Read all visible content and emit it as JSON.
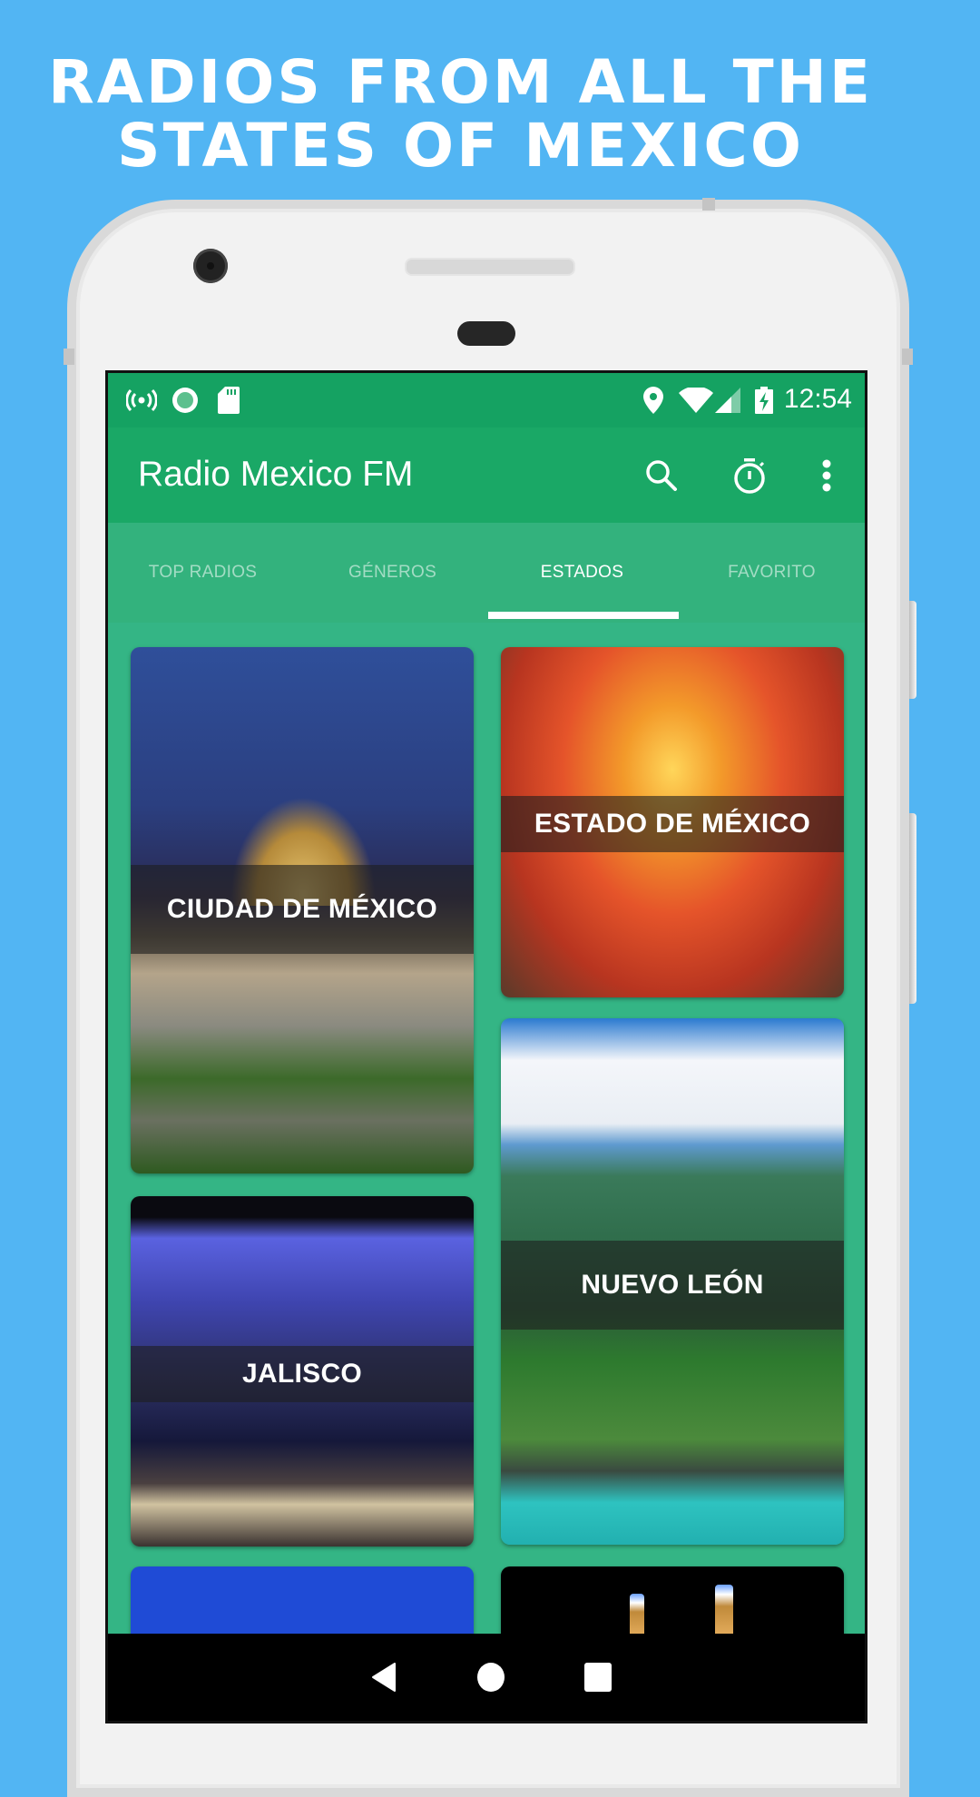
{
  "promo": {
    "headline_line1": "RADIOS FROM ALL THE",
    "headline_line2": "STATES OF MEXICO"
  },
  "status_bar": {
    "left_icons": [
      "broadcast-icon",
      "record-icon",
      "sd-card-icon"
    ],
    "right_icons": [
      "location-icon",
      "wifi-icon",
      "cell-signal-icon",
      "battery-charging-icon"
    ],
    "time": "12:54"
  },
  "app_bar": {
    "title": "Radio Mexico FM",
    "actions": [
      "search-icon",
      "timer-icon",
      "more-vert-icon"
    ]
  },
  "tabs": [
    {
      "label": "TOP RADIOS",
      "active": false
    },
    {
      "label": "GÉNEROS",
      "active": false
    },
    {
      "label": "ESTADOS",
      "active": true
    },
    {
      "label": "FAVORITO",
      "active": false
    }
  ],
  "states": [
    {
      "name": "CIUDAD DE MÉXICO"
    },
    {
      "name": "ESTADO DE MÉXICO"
    },
    {
      "name": "JALISCO"
    },
    {
      "name": "NUEVO LEÓN"
    },
    {
      "name": ""
    },
    {
      "name": ""
    }
  ],
  "nav_bar": {
    "buttons": [
      "back-icon",
      "home-icon",
      "recents-icon"
    ]
  },
  "colors": {
    "background": "#52b5f3",
    "primary": "#1aa866",
    "tab_bar": "#33b27d",
    "content": "#34b585"
  }
}
